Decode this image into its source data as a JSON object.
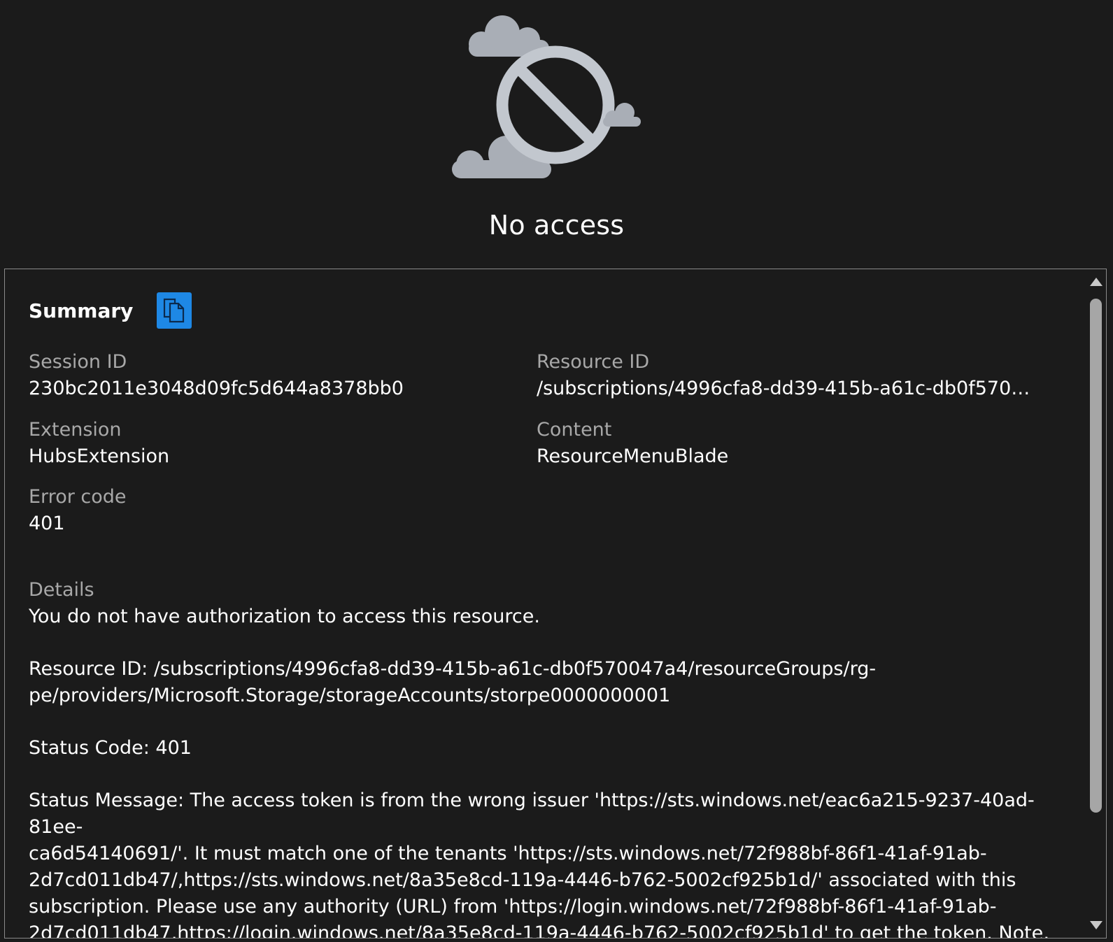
{
  "hero": {
    "icon": "no-access-cloud-icon",
    "title": "No access"
  },
  "summary": {
    "title": "Summary",
    "copy_icon": "copy-icon"
  },
  "fields": {
    "session_id_label": "Session ID",
    "session_id_value": "230bc2011e3048d09fc5d644a8378bb0",
    "resource_id_label": "Resource ID",
    "resource_id_value": "/subscriptions/4996cfa8-dd39-415b-a61c-db0f570047…",
    "extension_label": "Extension",
    "extension_value": "HubsExtension",
    "content_label": "Content",
    "content_value": "ResourceMenuBlade",
    "error_code_label": "Error code",
    "error_code_value": "401"
  },
  "details": {
    "label": "Details",
    "line1": "You do not have authorization to access this resource.",
    "resource_id": "Resource ID: /subscriptions/4996cfa8-dd39-415b-a61c-db0f570047a4/resourceGroups/rg-\npe/providers/Microsoft.Storage/storageAccounts/storpe0000000001",
    "status_code": "Status Code: 401",
    "status_message": "Status Message: The access token is from the wrong issuer 'https://sts.windows.net/eac6a215-9237-40ad-81ee-\nca6d54140691/'. It must match one of the tenants 'https://sts.windows.net/72f988bf-86f1-41af-91ab-\n2d7cd011db47/,https://sts.windows.net/8a35e8cd-119a-4446-b762-5002cf925b1d/' associated with this\nsubscription. Please use any authority (URL) from 'https://login.windows.net/72f988bf-86f1-41af-91ab-\n2d7cd011db47,https://login.windows.net/8a35e8cd-119a-4446-b762-5002cf925b1d' to get the token. Note, if the"
  },
  "colors": {
    "background": "#1b1b1b",
    "accent": "#1e88e5",
    "label": "#a8a8a8",
    "text": "#ffffff",
    "icon_gray": "#c2c7ce"
  }
}
